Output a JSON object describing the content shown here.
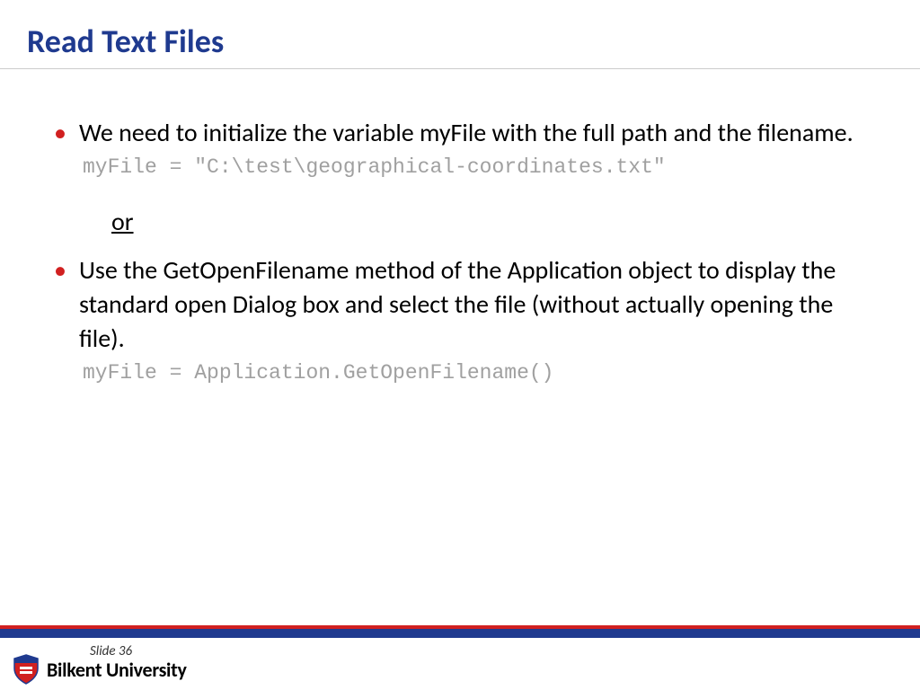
{
  "header": {
    "title": "Read Text Files"
  },
  "content": {
    "bullet1": {
      "text": "We need to initialize the variable myFile with the full path and the filename.",
      "code": "myFile = \"C:\\test\\geographical-coordinates.txt\""
    },
    "separator": "or",
    "bullet2": {
      "text": "Use the GetOpenFilename method of the Application object to display the standard open Dialog box and select the file (without actually opening the file).",
      "code": "myFile = Application.GetOpenFilename()"
    }
  },
  "footer": {
    "slideNumber": "Slide 36",
    "universityName": "Bilkent University"
  }
}
